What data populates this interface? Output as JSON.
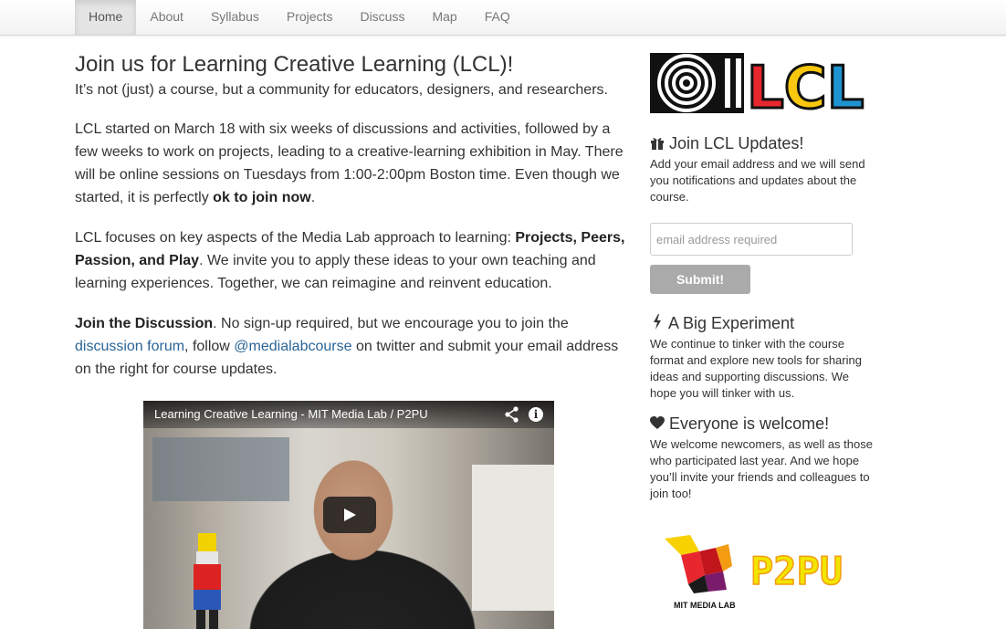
{
  "nav": {
    "items": [
      {
        "label": "Home",
        "active": true
      },
      {
        "label": "About"
      },
      {
        "label": "Syllabus"
      },
      {
        "label": "Projects"
      },
      {
        "label": "Discuss"
      },
      {
        "label": "Map"
      },
      {
        "label": "FAQ"
      }
    ]
  },
  "main": {
    "title": "Join us for Learning Creative Learning (LCL)!",
    "lead": "It’s not (just) a course, but a community for educators, designers, and researchers.",
    "p1_text": "LCL started on March 18 with six weeks of discussions and activities, followed by a few weeks to work on projects, leading to a creative-learning exhibition in May. There will be online sessions on Tuesdays from 1:00-2:00pm Boston time. Even though we started, it is perfectly ",
    "p1_bold": "ok to join now",
    "p1_end": ".",
    "p2_text": "LCL focuses on key aspects of the Media Lab approach to learning: ",
    "p2_bold": "Projects, Peers, Passion, and Play",
    "p2_end": ". We invite you to apply these ideas to your own teaching and learning experiences. Together, we can reimagine and reinvent education.",
    "p3_bold": "Join the Discussion",
    "p3_text1": ". No sign-up required, but we encourage you to join the ",
    "p3_link1": "discussion forum",
    "p3_text2": ", follow ",
    "p3_link2": "@medialabcourse",
    "p3_text3": " on twitter and submit your email address on the right for course updates.",
    "video_title": "Learning Creative Learning - MIT Media Lab / P2PU"
  },
  "sidebar": {
    "logo_text": "LCL",
    "updates_title": "Join LCL Updates!",
    "updates_text": "Add your email address and we will send you notifications and updates about the course.",
    "email_placeholder": "email address required",
    "submit_label": "Submit!",
    "experiment_title": "A Big Experiment",
    "experiment_text": "We continue to tinker with the course format and explore new tools for sharing ideas and supporting discussions. We hope you will tinker with us.",
    "welcome_title": "Everyone is welcome!",
    "welcome_text": "We welcome newcomers, as well as those who participated last year. And we hope you’ll invite your friends and colleagues to join too!",
    "mit_label": "MIT MEDIA LAB",
    "p2pu_label": "P2PU"
  },
  "colors": {
    "link": "#2a6496",
    "lcl_red": "#e8262d",
    "lcl_yellow": "#f9c80e",
    "lcl_blue": "#1f93d1",
    "p2pu_yellow": "#f2e500",
    "p2pu_orange": "#f39c12"
  },
  "icons": {
    "gift": "gift-icon",
    "bolt": "bolt-icon",
    "heart": "heart-icon",
    "share": "share-icon",
    "info": "info-icon",
    "play": "play-icon"
  }
}
